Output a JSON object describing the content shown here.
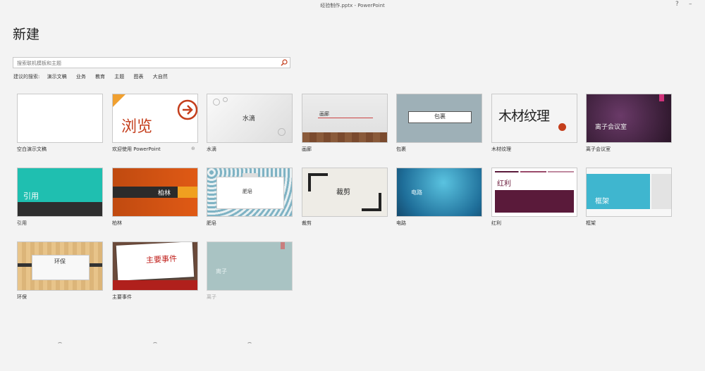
{
  "window": {
    "title": "经验制作.pptx - PowerPoint",
    "help": "?",
    "minimize": "–",
    "close": "✕"
  },
  "page": {
    "heading": "新建"
  },
  "search": {
    "placeholder": "搜索联机模板和主题",
    "icon": "search-icon"
  },
  "suggestions": {
    "label": "建议的搜索:",
    "items": [
      "演示文稿",
      "业务",
      "教育",
      "主题",
      "图表",
      "大自然"
    ]
  },
  "templates": [
    {
      "caption": "空白演示文稿"
    },
    {
      "caption": "欢迎使用 PowerPoint",
      "thumb_text": "浏览",
      "pin": "⊕"
    },
    {
      "caption": "水滴",
      "thumb_text": "水滴"
    },
    {
      "caption": "画廊",
      "thumb_text": "画廊"
    },
    {
      "caption": "包裹",
      "thumb_text": "包裹"
    },
    {
      "caption": "木材纹理",
      "thumb_text": "木材纹理"
    },
    {
      "caption": "离子会议室",
      "thumb_text": "离子会议室"
    },
    {
      "caption": "引用",
      "thumb_text": "引用"
    },
    {
      "caption": "柏林",
      "thumb_text": "柏林"
    },
    {
      "caption": "肥皂",
      "thumb_text": "肥皂"
    },
    {
      "caption": "裁剪",
      "thumb_text": "裁剪"
    },
    {
      "caption": "电路",
      "thumb_text": "电路"
    },
    {
      "caption": "红利",
      "thumb_text": "红利"
    },
    {
      "caption": "框架",
      "thumb_text": "框架"
    },
    {
      "caption": "环保",
      "thumb_text": "环保"
    },
    {
      "caption": "主要事件",
      "thumb_text": "主要事件"
    },
    {
      "caption": "离子",
      "thumb_text": "离子"
    }
  ],
  "colors": {
    "accent": "#c43e1c",
    "ion_purple": "#5a2a55",
    "teal": "#1fbfb0",
    "circuit_blue": "#2a9ec8",
    "dividend": "#5a1a3a",
    "frame_blue": "#3fb6cf"
  }
}
